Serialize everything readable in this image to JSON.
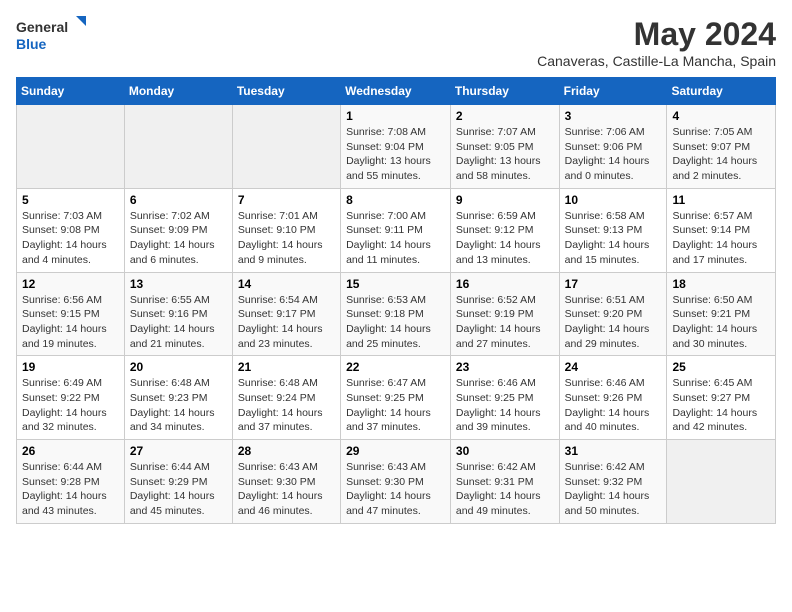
{
  "logo": {
    "line1": "General",
    "line2": "Blue"
  },
  "title": "May 2024",
  "subtitle": "Canaveras, Castille-La Mancha, Spain",
  "days_header": [
    "Sunday",
    "Monday",
    "Tuesday",
    "Wednesday",
    "Thursday",
    "Friday",
    "Saturday"
  ],
  "weeks": [
    [
      {
        "num": "",
        "info": ""
      },
      {
        "num": "",
        "info": ""
      },
      {
        "num": "",
        "info": ""
      },
      {
        "num": "1",
        "info": "Sunrise: 7:08 AM\nSunset: 9:04 PM\nDaylight: 13 hours\nand 55 minutes."
      },
      {
        "num": "2",
        "info": "Sunrise: 7:07 AM\nSunset: 9:05 PM\nDaylight: 13 hours\nand 58 minutes."
      },
      {
        "num": "3",
        "info": "Sunrise: 7:06 AM\nSunset: 9:06 PM\nDaylight: 14 hours\nand 0 minutes."
      },
      {
        "num": "4",
        "info": "Sunrise: 7:05 AM\nSunset: 9:07 PM\nDaylight: 14 hours\nand 2 minutes."
      }
    ],
    [
      {
        "num": "5",
        "info": "Sunrise: 7:03 AM\nSunset: 9:08 PM\nDaylight: 14 hours\nand 4 minutes."
      },
      {
        "num": "6",
        "info": "Sunrise: 7:02 AM\nSunset: 9:09 PM\nDaylight: 14 hours\nand 6 minutes."
      },
      {
        "num": "7",
        "info": "Sunrise: 7:01 AM\nSunset: 9:10 PM\nDaylight: 14 hours\nand 9 minutes."
      },
      {
        "num": "8",
        "info": "Sunrise: 7:00 AM\nSunset: 9:11 PM\nDaylight: 14 hours\nand 11 minutes."
      },
      {
        "num": "9",
        "info": "Sunrise: 6:59 AM\nSunset: 9:12 PM\nDaylight: 14 hours\nand 13 minutes."
      },
      {
        "num": "10",
        "info": "Sunrise: 6:58 AM\nSunset: 9:13 PM\nDaylight: 14 hours\nand 15 minutes."
      },
      {
        "num": "11",
        "info": "Sunrise: 6:57 AM\nSunset: 9:14 PM\nDaylight: 14 hours\nand 17 minutes."
      }
    ],
    [
      {
        "num": "12",
        "info": "Sunrise: 6:56 AM\nSunset: 9:15 PM\nDaylight: 14 hours\nand 19 minutes."
      },
      {
        "num": "13",
        "info": "Sunrise: 6:55 AM\nSunset: 9:16 PM\nDaylight: 14 hours\nand 21 minutes."
      },
      {
        "num": "14",
        "info": "Sunrise: 6:54 AM\nSunset: 9:17 PM\nDaylight: 14 hours\nand 23 minutes."
      },
      {
        "num": "15",
        "info": "Sunrise: 6:53 AM\nSunset: 9:18 PM\nDaylight: 14 hours\nand 25 minutes."
      },
      {
        "num": "16",
        "info": "Sunrise: 6:52 AM\nSunset: 9:19 PM\nDaylight: 14 hours\nand 27 minutes."
      },
      {
        "num": "17",
        "info": "Sunrise: 6:51 AM\nSunset: 9:20 PM\nDaylight: 14 hours\nand 29 minutes."
      },
      {
        "num": "18",
        "info": "Sunrise: 6:50 AM\nSunset: 9:21 PM\nDaylight: 14 hours\nand 30 minutes."
      }
    ],
    [
      {
        "num": "19",
        "info": "Sunrise: 6:49 AM\nSunset: 9:22 PM\nDaylight: 14 hours\nand 32 minutes."
      },
      {
        "num": "20",
        "info": "Sunrise: 6:48 AM\nSunset: 9:23 PM\nDaylight: 14 hours\nand 34 minutes."
      },
      {
        "num": "21",
        "info": "Sunrise: 6:48 AM\nSunset: 9:24 PM\nDaylight: 14 hours\nand 37 minutes."
      },
      {
        "num": "22",
        "info": "Sunrise: 6:47 AM\nSunset: 9:25 PM\nDaylight: 14 hours\nand 37 minutes."
      },
      {
        "num": "23",
        "info": "Sunrise: 6:46 AM\nSunset: 9:25 PM\nDaylight: 14 hours\nand 39 minutes."
      },
      {
        "num": "24",
        "info": "Sunrise: 6:46 AM\nSunset: 9:26 PM\nDaylight: 14 hours\nand 40 minutes."
      },
      {
        "num": "25",
        "info": "Sunrise: 6:45 AM\nSunset: 9:27 PM\nDaylight: 14 hours\nand 42 minutes."
      }
    ],
    [
      {
        "num": "26",
        "info": "Sunrise: 6:44 AM\nSunset: 9:28 PM\nDaylight: 14 hours\nand 43 minutes."
      },
      {
        "num": "27",
        "info": "Sunrise: 6:44 AM\nSunset: 9:29 PM\nDaylight: 14 hours\nand 45 minutes."
      },
      {
        "num": "28",
        "info": "Sunrise: 6:43 AM\nSunset: 9:30 PM\nDaylight: 14 hours\nand 46 minutes."
      },
      {
        "num": "29",
        "info": "Sunrise: 6:43 AM\nSunset: 9:30 PM\nDaylight: 14 hours\nand 47 minutes."
      },
      {
        "num": "30",
        "info": "Sunrise: 6:42 AM\nSunset: 9:31 PM\nDaylight: 14 hours\nand 49 minutes."
      },
      {
        "num": "31",
        "info": "Sunrise: 6:42 AM\nSunset: 9:32 PM\nDaylight: 14 hours\nand 50 minutes."
      },
      {
        "num": "",
        "info": ""
      }
    ]
  ]
}
